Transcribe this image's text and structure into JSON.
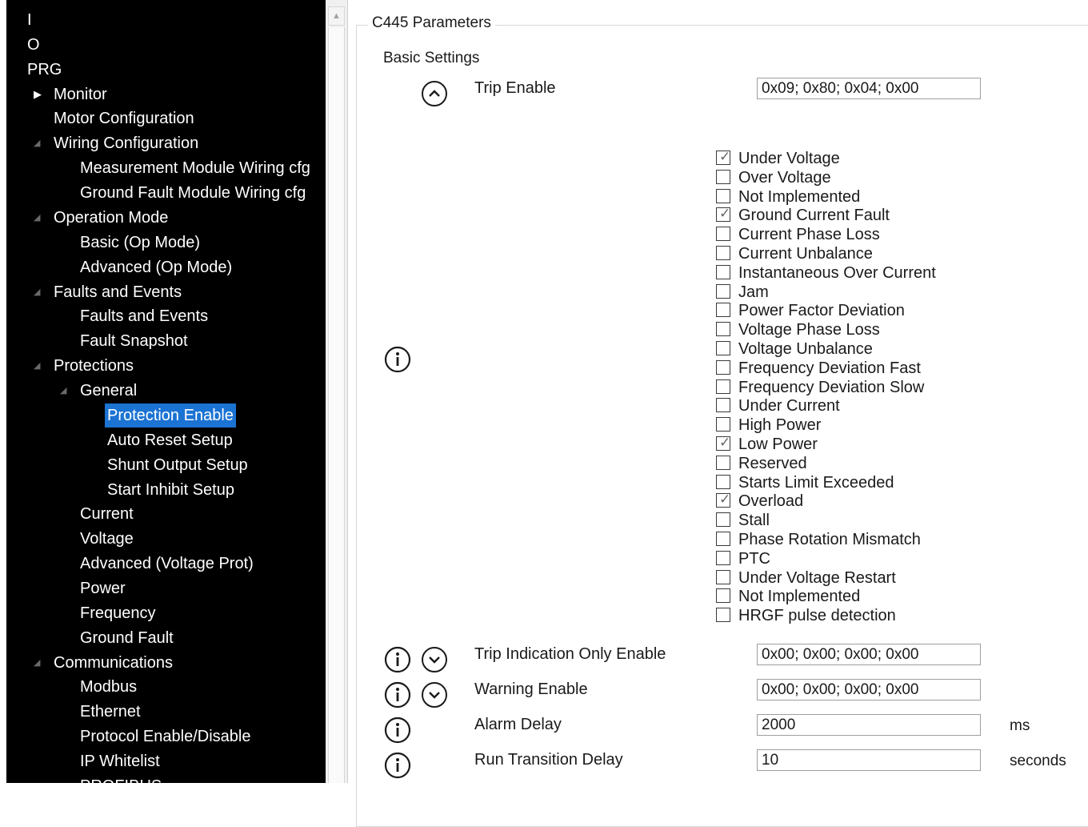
{
  "tree": [
    {
      "label": "I",
      "level": 0
    },
    {
      "label": "O",
      "level": 0
    },
    {
      "label": "PRG",
      "level": 0
    },
    {
      "label": "Monitor",
      "level": 1,
      "expander": "collapsed"
    },
    {
      "label": "Motor Configuration",
      "level": 1
    },
    {
      "label": "Wiring Configuration",
      "level": 1,
      "expander": "expanded"
    },
    {
      "label": "Measurement Module Wiring cfg",
      "level": 2
    },
    {
      "label": "Ground Fault Module Wiring cfg",
      "level": 2
    },
    {
      "label": "Operation Mode",
      "level": 1,
      "expander": "expanded"
    },
    {
      "label": "Basic (Op Mode)",
      "level": 2
    },
    {
      "label": "Advanced (Op Mode)",
      "level": 2
    },
    {
      "label": "Faults and Events",
      "level": 1,
      "expander": "expanded"
    },
    {
      "label": "Faults and Events",
      "level": 2
    },
    {
      "label": "Fault Snapshot",
      "level": 2
    },
    {
      "label": "Protections",
      "level": 1,
      "expander": "expanded"
    },
    {
      "label": "General",
      "level": 2,
      "expander": "expanded"
    },
    {
      "label": "Protection Enable",
      "level": 3,
      "selected": true
    },
    {
      "label": "Auto Reset Setup",
      "level": 3
    },
    {
      "label": "Shunt Output Setup",
      "level": 3
    },
    {
      "label": "Start Inhibit Setup",
      "level": 3
    },
    {
      "label": "Current",
      "level": 2
    },
    {
      "label": "Voltage",
      "level": 2
    },
    {
      "label": "Advanced (Voltage Prot)",
      "level": 2
    },
    {
      "label": "Power",
      "level": 2
    },
    {
      "label": "Frequency",
      "level": 2
    },
    {
      "label": "Ground Fault",
      "level": 2
    },
    {
      "label": "Communications",
      "level": 1,
      "expander": "expanded"
    },
    {
      "label": "Modbus",
      "level": 2
    },
    {
      "label": "Ethernet",
      "level": 2
    },
    {
      "label": "Protocol Enable/Disable",
      "level": 2
    },
    {
      "label": "IP Whitelist",
      "level": 2
    },
    {
      "label": "PROFIBUS",
      "level": 2
    }
  ],
  "panel": {
    "group_title": "C445 Parameters",
    "section_title": "Basic Settings"
  },
  "params": {
    "trip_enable": {
      "label": "Trip Enable",
      "value": "0x09; 0x80; 0x04; 0x00"
    },
    "trip_indication": {
      "label": "Trip Indication Only Enable",
      "value": "0x00; 0x00; 0x00; 0x00"
    },
    "warning_enable": {
      "label": "Warning Enable",
      "value": "0x00; 0x00; 0x00; 0x00"
    },
    "alarm_delay": {
      "label": "Alarm Delay",
      "value": "2000",
      "unit": "ms"
    },
    "run_transition": {
      "label": "Run Transition Delay",
      "value": "10",
      "unit": "seconds"
    }
  },
  "trip_flags": [
    {
      "label": "Under Voltage",
      "checked": true
    },
    {
      "label": "Over Voltage",
      "checked": false
    },
    {
      "label": "Not Implemented",
      "checked": false
    },
    {
      "label": "Ground Current Fault",
      "checked": true
    },
    {
      "label": "Current Phase Loss",
      "checked": false
    },
    {
      "label": "Current Unbalance",
      "checked": false
    },
    {
      "label": "Instantaneous Over Current",
      "checked": false
    },
    {
      "label": "Jam",
      "checked": false
    },
    {
      "label": "Power Factor Deviation",
      "checked": false
    },
    {
      "label": "Voltage Phase Loss",
      "checked": false
    },
    {
      "label": "Voltage Unbalance",
      "checked": false
    },
    {
      "label": "Frequency Deviation Fast",
      "checked": false
    },
    {
      "label": "Frequency Deviation Slow",
      "checked": false
    },
    {
      "label": "Under Current",
      "checked": false
    },
    {
      "label": "High Power",
      "checked": false
    },
    {
      "label": "Low Power",
      "checked": true
    },
    {
      "label": "Reserved",
      "checked": false
    },
    {
      "label": "Starts Limit Exceeded",
      "checked": false
    },
    {
      "label": "Overload",
      "checked": true
    },
    {
      "label": "Stall",
      "checked": false
    },
    {
      "label": "Phase Rotation Mismatch",
      "checked": false
    },
    {
      "label": "PTC",
      "checked": false
    },
    {
      "label": "Under Voltage Restart",
      "checked": false
    },
    {
      "label": "Not Implemented",
      "checked": false
    },
    {
      "label": "HRGF pulse detection",
      "checked": false
    }
  ],
  "icons": {
    "info": "info-circle-icon",
    "collapse": "chevron-up-circle-icon",
    "expand": "chevron-down-circle-icon"
  },
  "colors": {
    "tree_bg": "#000000",
    "tree_text": "#ffffff",
    "selection": "#1b73d3"
  }
}
